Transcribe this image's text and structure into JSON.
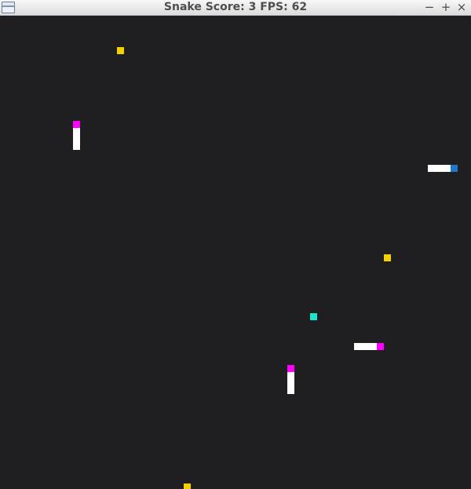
{
  "window": {
    "title": "Snake Score: 3 FPS: 62",
    "controls": {
      "minimize": "−",
      "maximize": "+",
      "close": "×"
    }
  },
  "game": {
    "score": 3,
    "fps": 62,
    "colors": {
      "background": "#1f1e21",
      "food": "#f5d000",
      "bonus": "#18e5d2",
      "snake_body": "#ffffff",
      "enemy_head": "#ff00ff",
      "player_head": "#1e78c8"
    },
    "items": {
      "food": [
        "food",
        "food",
        "food"
      ],
      "bonus": "bonus-item"
    },
    "snakes": {
      "player": {
        "direction": "right",
        "length_cells": 4
      },
      "enemy_1": {
        "direction": "up",
        "length_cells": 4
      },
      "enemy_2": {
        "direction": "right",
        "length_cells": 4
      },
      "enemy_3": {
        "direction": "up",
        "length_cells": 4
      }
    }
  }
}
